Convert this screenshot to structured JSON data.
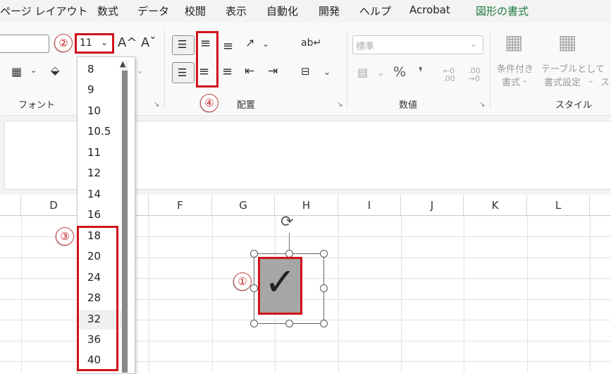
{
  "menu": {
    "items": [
      "ページ レイアウト",
      "数式",
      "データ",
      "校閲",
      "表示",
      "自動化",
      "開発",
      "ヘルプ",
      "Acrobat",
      "図形の書式"
    ]
  },
  "ribbon": {
    "font": {
      "size_value": "11",
      "grow_icon": "A^",
      "shrink_icon": "Aˇ",
      "label": "フォント"
    },
    "alignment": {
      "label": "配置"
    },
    "number": {
      "format_value": "標準",
      "percent": "%",
      "comma": "❜",
      "inc_decimal": "←0 .00",
      "dec_decimal": ".00 →0",
      "label": "数値"
    },
    "styles": {
      "conditional_line1": "条件付き",
      "conditional_line2": "書式",
      "table_line1": "テーブルとして",
      "table_line2": "書式設定",
      "cell_styles_partial": "ス",
      "label": "スタイル"
    }
  },
  "callouts": {
    "one": "①",
    "two": "②",
    "three": "③",
    "four": "④"
  },
  "columns": [
    "D",
    "F",
    "G",
    "H",
    "I",
    "J",
    "K",
    "L"
  ],
  "font_sizes": [
    "8",
    "9",
    "10",
    "10.5",
    "11",
    "12",
    "14",
    "16",
    "18",
    "20",
    "24",
    "28",
    "32",
    "36",
    "40"
  ],
  "shape": {
    "glyph": "✓",
    "fill_color": "#a6a6a6"
  },
  "colors": {
    "accent_red": "#d0121b",
    "tab_green": "#1e7a3c"
  }
}
